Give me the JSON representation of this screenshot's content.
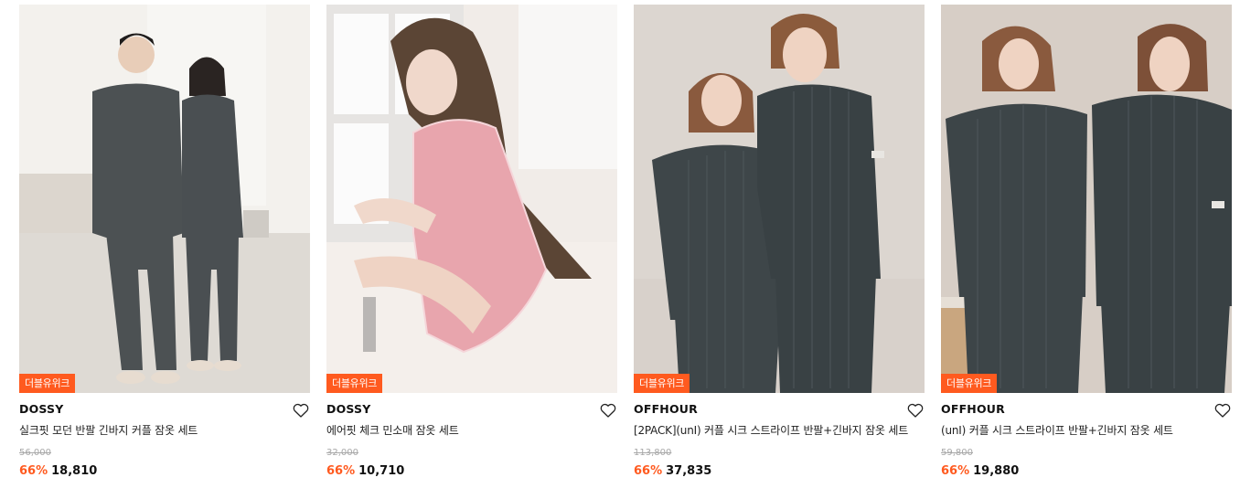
{
  "products": [
    {
      "badge": "더블유위크",
      "brand": "DOSSY",
      "name": "실크핏 모던 반팔 긴바지 커플 잠옷 세트",
      "original_price": "56,000",
      "discount": "66%",
      "price": "18,810",
      "wishlist_icon": "heart-outline-icon",
      "image_description_colors": {
        "background": "#e4e1dc",
        "garment": "#4b5052"
      }
    },
    {
      "badge": "더블유위크",
      "brand": "DOSSY",
      "name": "에어핏 체크 민소매 잠옷 세트",
      "original_price": "32,000",
      "discount": "66%",
      "price": "10,710",
      "wishlist_icon": "heart-outline-icon",
      "image_description_colors": {
        "background": "#f1ece9",
        "garment": "#e4a0a8"
      }
    },
    {
      "badge": "더블유위크",
      "brand": "OFFHOUR",
      "name": "[2PACK](unI) 커플 시크 스트라이프 반팔+긴바지 잠옷 세트",
      "original_price": "113,800",
      "discount": "66%",
      "price": "37,835",
      "wishlist_icon": "heart-outline-icon",
      "image_description_colors": {
        "background": "#d9d2cc",
        "garment": "#3c4447"
      }
    },
    {
      "badge": "더블유위크",
      "brand": "OFFHOUR",
      "name": "(unI) 커플 시크 스트라이프 반팔+긴바지 잠옷 세트",
      "original_price": "59,800",
      "discount": "66%",
      "price": "19,880",
      "wishlist_icon": "heart-outline-icon",
      "image_description_colors": {
        "background": "#d8d0c8",
        "garment": "#3d4548"
      }
    }
  ],
  "colors": {
    "accent": "#ff5a1f",
    "text": "#111111",
    "muted": "#a8a8a8"
  }
}
